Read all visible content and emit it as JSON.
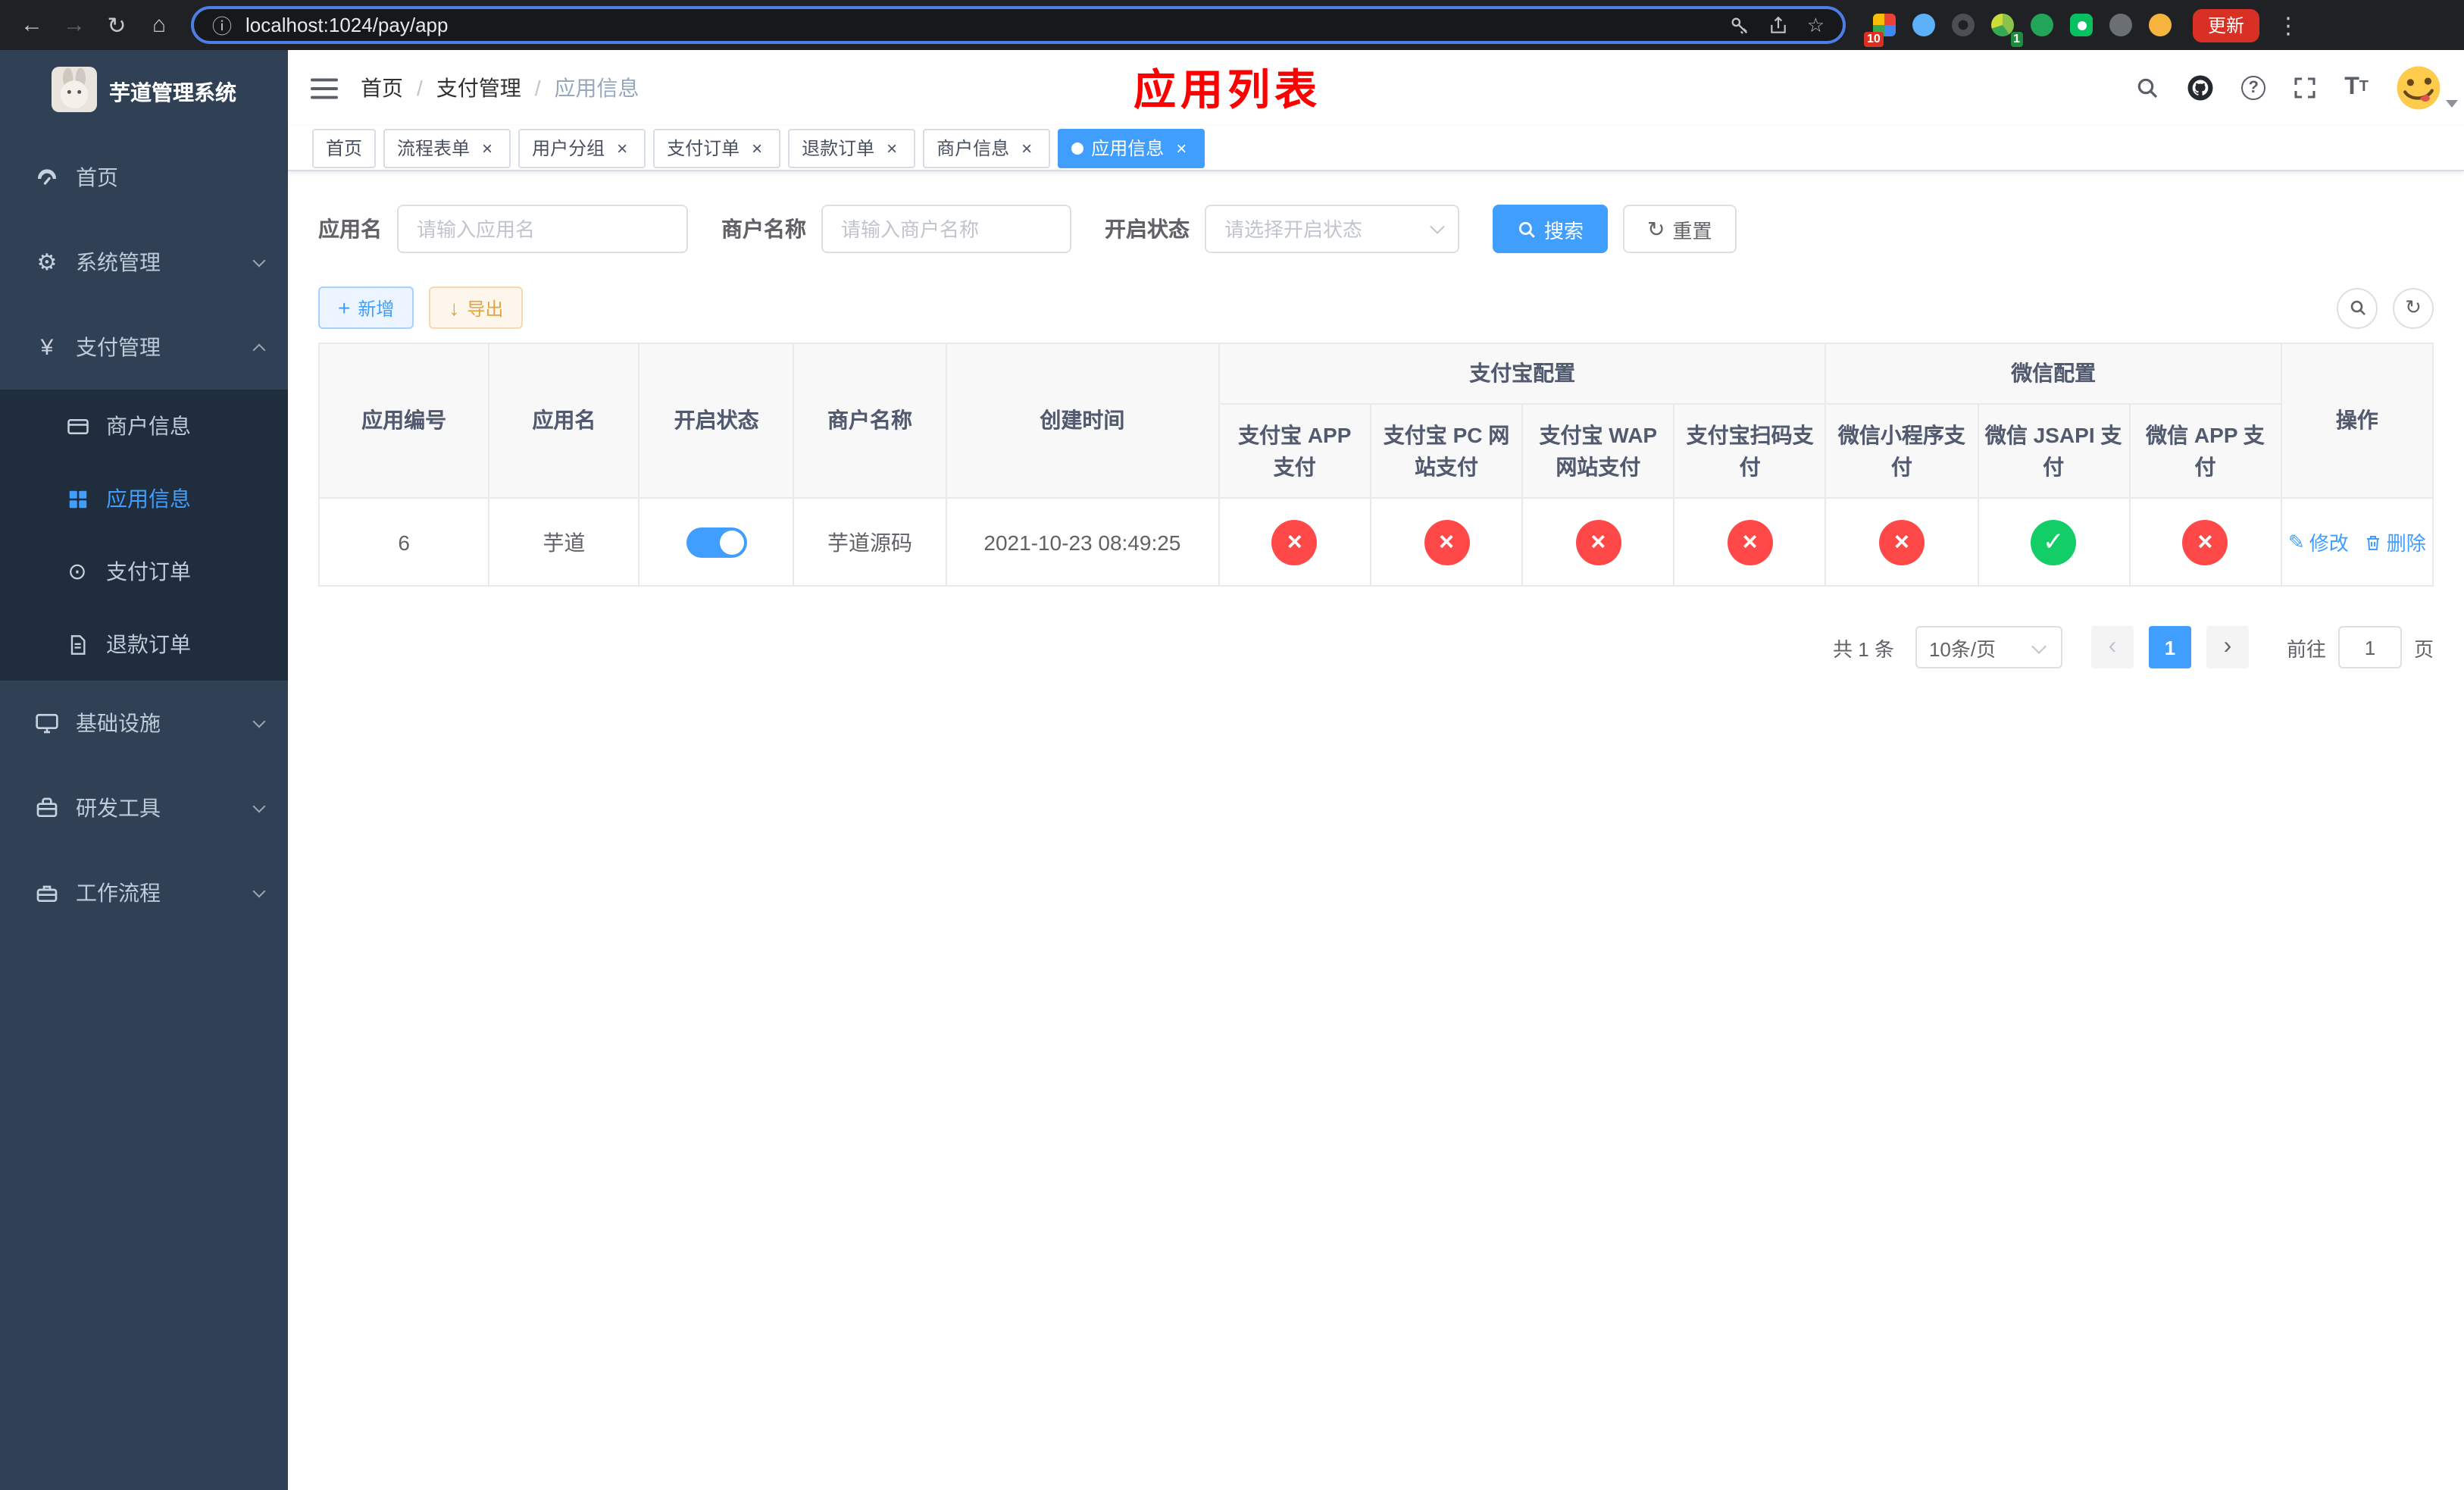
{
  "browser": {
    "url": "localhost:1024/pay/app",
    "update_label": "更新",
    "ext_badge_red": "10",
    "ext_badge_green": "1"
  },
  "sidebar": {
    "app_title": "芋道管理系统",
    "items": [
      {
        "label": "首页"
      },
      {
        "label": "系统管理"
      },
      {
        "label": "支付管理"
      },
      {
        "label": "商户信息"
      },
      {
        "label": "应用信息"
      },
      {
        "label": "支付订单"
      },
      {
        "label": "退款订单"
      },
      {
        "label": "基础设施"
      },
      {
        "label": "研发工具"
      },
      {
        "label": "工作流程"
      }
    ]
  },
  "navbar": {
    "breadcrumb": [
      {
        "label": "首页"
      },
      {
        "label": "支付管理"
      },
      {
        "label": "应用信息"
      }
    ],
    "separator": "/",
    "page_title": "应用列表"
  },
  "tabs": [
    {
      "label": "首页"
    },
    {
      "label": "流程表单"
    },
    {
      "label": "用户分组"
    },
    {
      "label": "支付订单"
    },
    {
      "label": "退款订单"
    },
    {
      "label": "商户信息"
    },
    {
      "label": "应用信息"
    }
  ],
  "search": {
    "app_name_label": "应用名",
    "app_name_placeholder": "请输入应用名",
    "merchant_label": "商户名称",
    "merchant_placeholder": "请输入商户名称",
    "status_label": "开启状态",
    "status_placeholder": "请选择开启状态",
    "search_label": "搜索",
    "reset_label": "重置"
  },
  "toolbar": {
    "add_label": "新增",
    "export_label": "导出"
  },
  "table": {
    "columns": {
      "id": "应用编号",
      "name": "应用名",
      "status": "开启状态",
      "merchant": "商户名称",
      "created": "创建时间",
      "actions": "操作"
    },
    "groups": {
      "alipay": "支付宝配置",
      "wechat": "微信配置"
    },
    "sub_columns": [
      "支付宝 APP 支付",
      "支付宝 PC 网站支付",
      "支付宝 WAP 网站支付",
      "支付宝扫码支付",
      "微信小程序支付",
      "微信 JSAPI 支付",
      "微信 APP 支付"
    ],
    "rows": [
      {
        "id": "6",
        "name": "芋道",
        "enabled": true,
        "merchant": "芋道源码",
        "created": "2021-10-23 08:49:25",
        "alipay_app": false,
        "alipay_pc": false,
        "alipay_wap": false,
        "alipay_qr": false,
        "wechat_lite": false,
        "wechat_jsapi": true,
        "wechat_app": false
      }
    ],
    "row_actions": {
      "edit": "修改",
      "delete": "删除"
    }
  },
  "pagination": {
    "total": "共 1 条",
    "page_size": "10条/页",
    "page": "1",
    "prev": "‹",
    "next": "›",
    "goto": "前往",
    "goto_value": "1",
    "unit": "页"
  },
  "icons": {
    "back": "←",
    "forward": "→",
    "reload": "↻",
    "home": "⌂",
    "info": "ⓘ",
    "star": "☆",
    "more": "⋮",
    "check": "✓",
    "cross": "×",
    "plus": "+",
    "download": "↓",
    "question": "?",
    "yen": "¥",
    "gear": "⚙",
    "order": "⊙",
    "edit": "✎",
    "font": "T"
  },
  "colors": {
    "accent": "#409eff",
    "danger": "#ff4949",
    "success": "#13ce66"
  }
}
